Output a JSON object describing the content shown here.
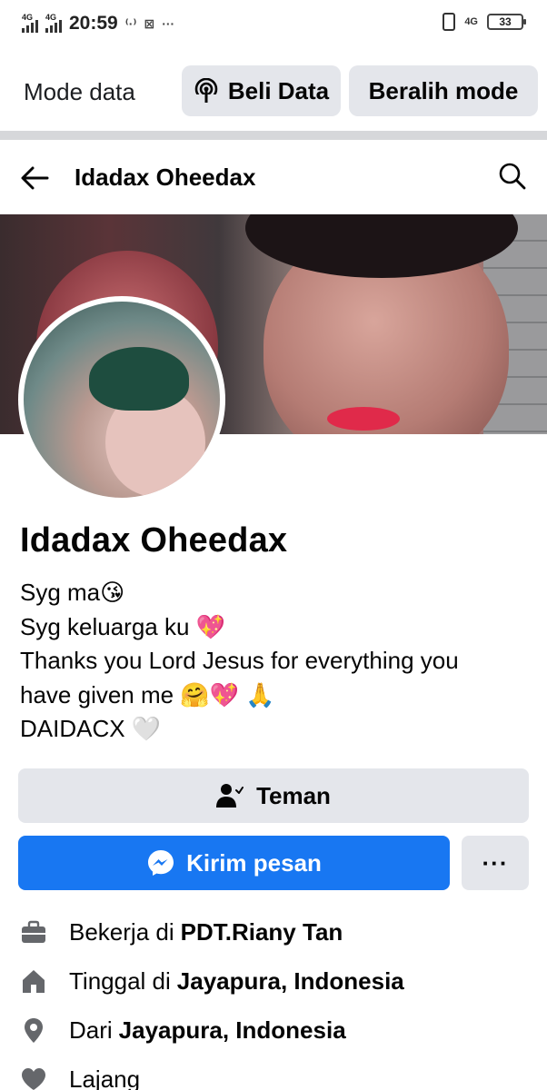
{
  "status_bar": {
    "signal1_label": "4G",
    "signal2_label": "4G",
    "time": "20:59",
    "network_right": "4G",
    "battery": "33"
  },
  "data_mode": {
    "label": "Mode data",
    "buy_data_label": "Beli Data",
    "switch_mode_label": "Beralih mode"
  },
  "header": {
    "title": "Idadax Oheedax"
  },
  "profile": {
    "name": "Idadax Oheedax",
    "bio": [
      "Syg ma😘",
      "Syg keluarga ku 💖",
      "Thanks you Lord Jesus for everything you",
      "have given me 🤗💖 🙏",
      "DAIDACX 🤍"
    ]
  },
  "actions": {
    "friend_label": "Teman",
    "message_label": "Kirim pesan",
    "more_label": "···"
  },
  "details": [
    {
      "icon": "briefcase-icon",
      "prefix": "Bekerja di",
      "value": "PDT.Riany Tan"
    },
    {
      "icon": "home-icon",
      "prefix": "Tinggal di",
      "value": "Jayapura, Indonesia"
    },
    {
      "icon": "location-pin-icon",
      "prefix": "Dari",
      "value": "Jayapura, Indonesia"
    },
    {
      "icon": "heart-icon",
      "prefix": "Lajang",
      "value": ""
    }
  ],
  "colors": {
    "accent": "#1877f2",
    "button_gray": "#e4e6eb",
    "icon_gray": "#65676b"
  }
}
